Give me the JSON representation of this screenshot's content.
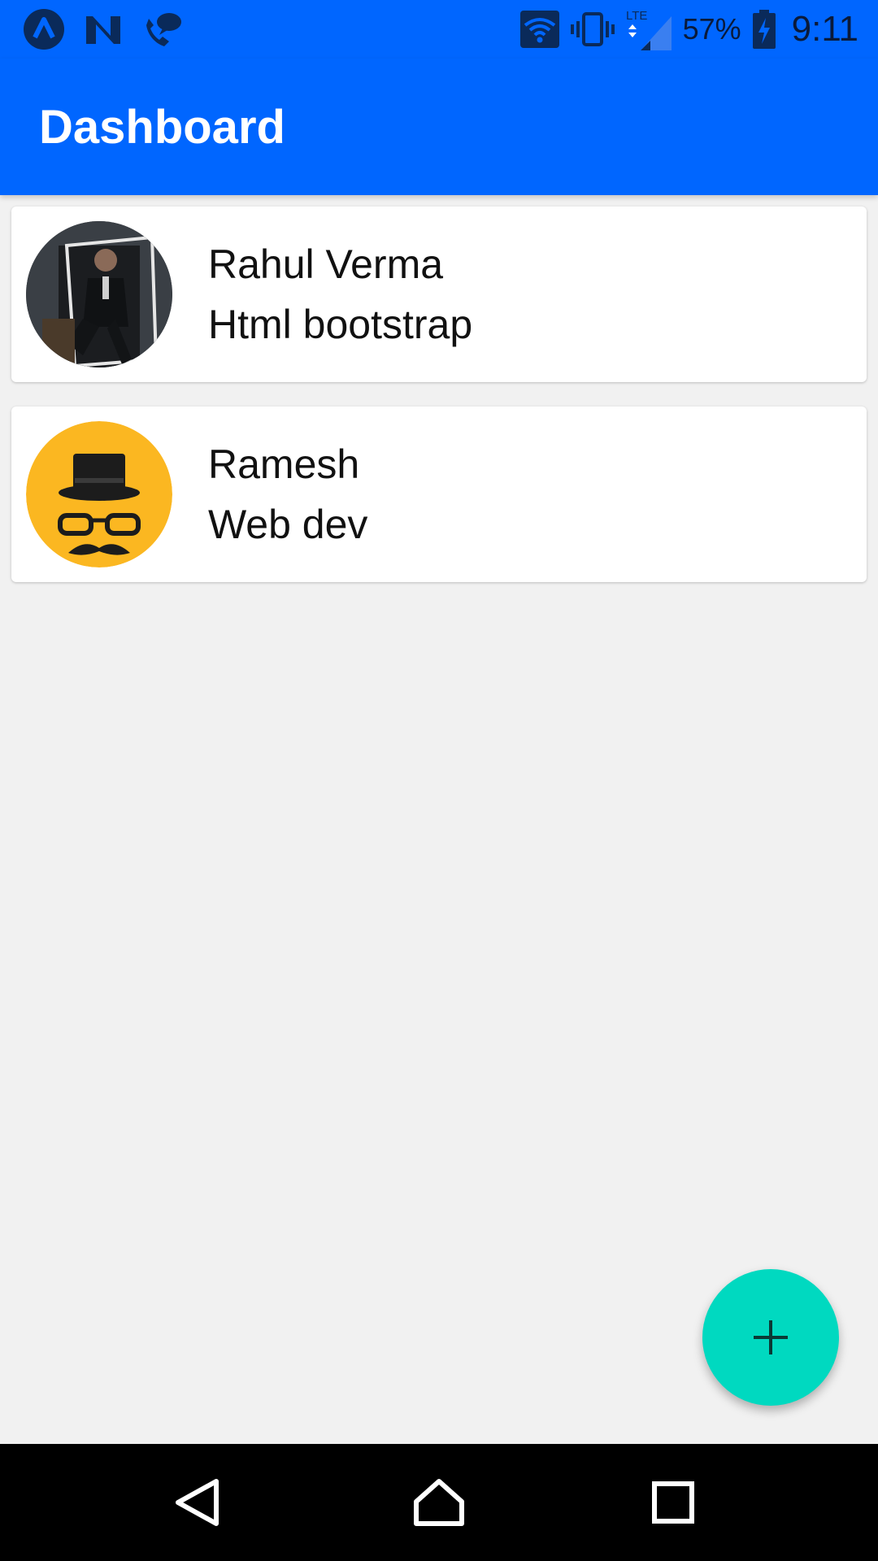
{
  "status_bar": {
    "icons_left": [
      "app-a-icon",
      "app-n-icon",
      "phone-chat-icon"
    ],
    "icons_right": [
      "wifi-icon",
      "vibrate-icon",
      "lte-signal-icon",
      "battery-charging-icon"
    ],
    "lte_label": "LTE",
    "battery_percent": "57%",
    "time": "9:11"
  },
  "app_bar": {
    "title": "Dashboard",
    "color": "#0066ff"
  },
  "contacts": [
    {
      "name": "Rahul Verma",
      "role": "Html bootstrap",
      "avatar": "photo-avatar"
    },
    {
      "name": "Ramesh",
      "role": "Web dev",
      "avatar": "hat-glasses-mustache-avatar"
    }
  ],
  "fab": {
    "icon": "plus-icon",
    "color": "#00d9c0"
  },
  "nav_bar": {
    "icons": [
      "back-icon",
      "home-icon",
      "recents-icon"
    ]
  }
}
